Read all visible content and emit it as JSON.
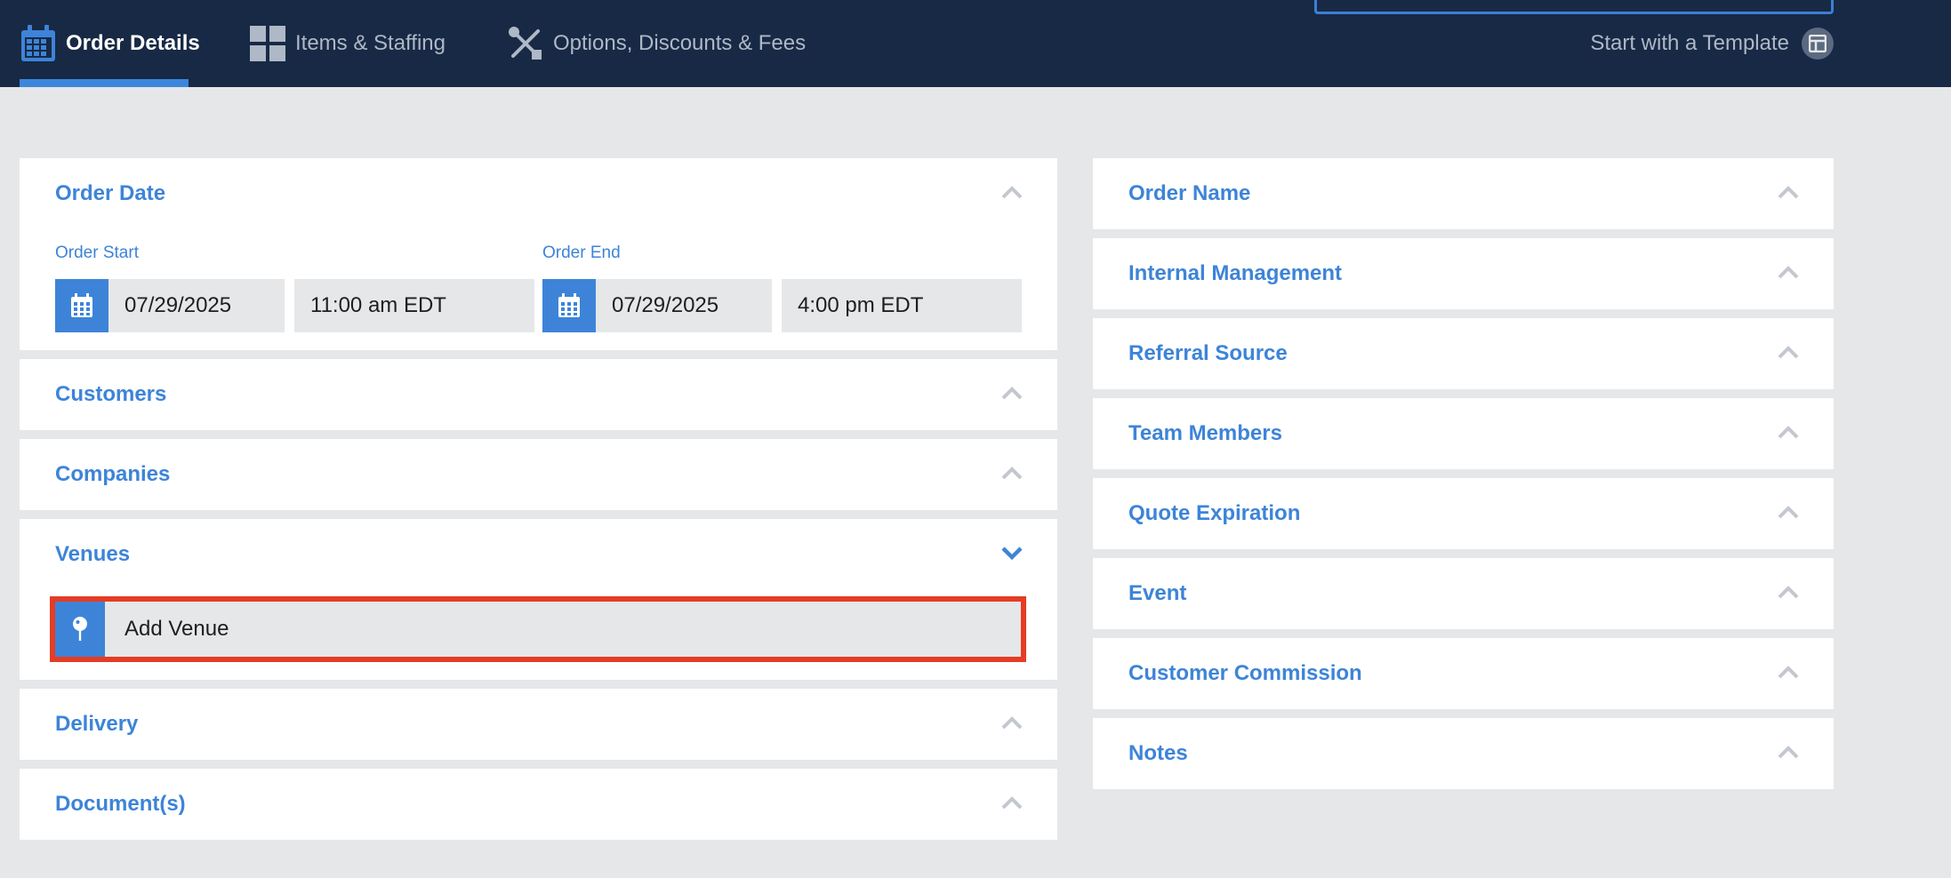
{
  "tabs": [
    {
      "label": "Order Details",
      "icon": "calendar-icon",
      "active": true
    },
    {
      "label": "Items & Staffing",
      "icon": "grid-icon",
      "active": false
    },
    {
      "label": "Options, Discounts & Fees",
      "icon": "tools-icon",
      "active": false
    }
  ],
  "template_link": {
    "label": "Start with a Template",
    "icon": "template-icon"
  },
  "left_panels": {
    "order_date": {
      "title": "Order Date",
      "start_label": "Order Start",
      "start_date": "07/29/2025",
      "start_time": "11:00 am EDT",
      "end_label": "Order End",
      "end_date": "07/29/2025",
      "end_time": "4:00 pm EDT"
    },
    "customers": {
      "title": "Customers"
    },
    "companies": {
      "title": "Companies"
    },
    "venues": {
      "title": "Venues",
      "add_label": "Add Venue"
    },
    "delivery": {
      "title": "Delivery"
    },
    "documents": {
      "title": "Document(s)"
    }
  },
  "right_panels": [
    {
      "title": "Order Name"
    },
    {
      "title": "Internal Management"
    },
    {
      "title": "Referral Source"
    },
    {
      "title": "Team Members"
    },
    {
      "title": "Quote Expiration"
    },
    {
      "title": "Event"
    },
    {
      "title": "Customer Commission"
    },
    {
      "title": "Notes"
    }
  ],
  "colors": {
    "topbar": "#172944",
    "accent": "#3d84d8",
    "highlight": "#e53c25",
    "background": "#e6e7e9"
  }
}
